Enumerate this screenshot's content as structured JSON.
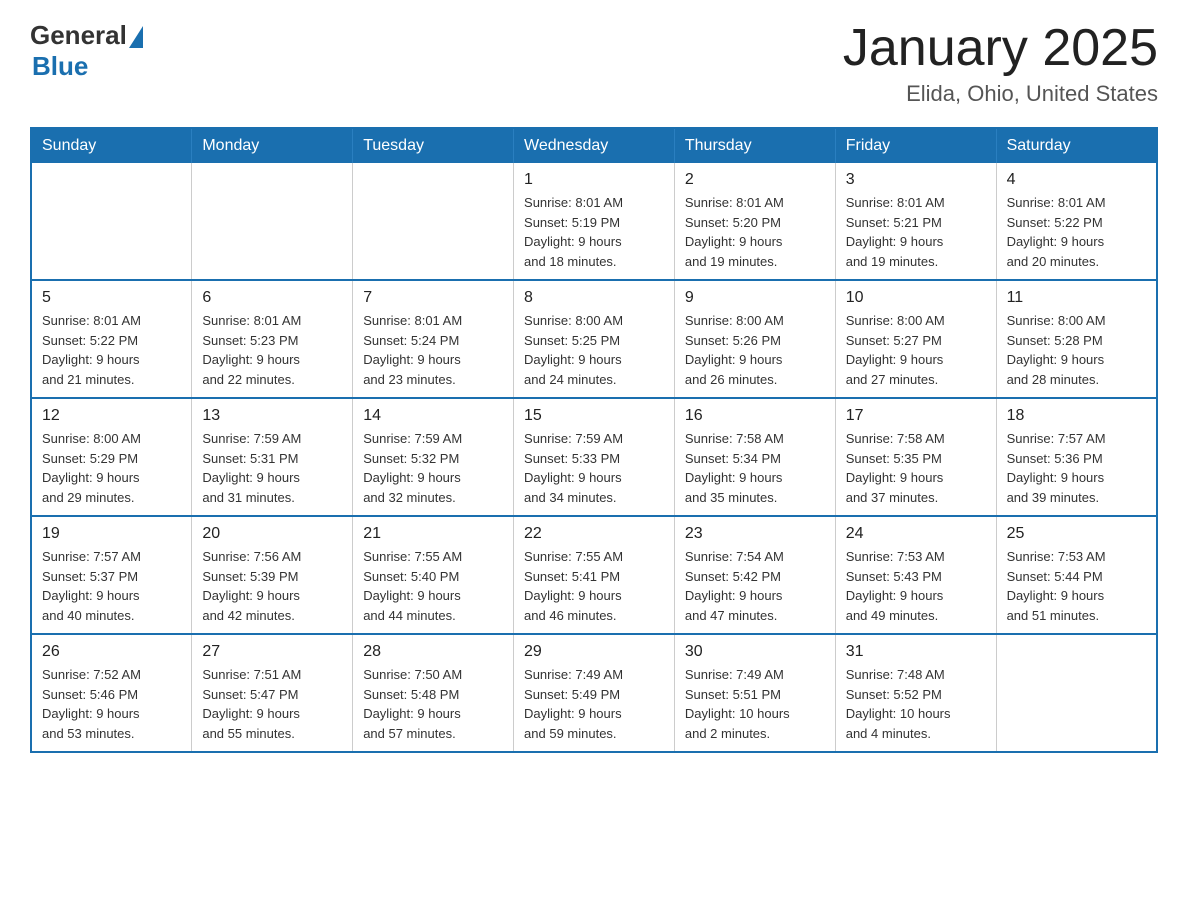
{
  "logo": {
    "general": "General",
    "blue": "Blue"
  },
  "title": "January 2025",
  "location": "Elida, Ohio, United States",
  "days_of_week": [
    "Sunday",
    "Monday",
    "Tuesday",
    "Wednesday",
    "Thursday",
    "Friday",
    "Saturday"
  ],
  "weeks": [
    [
      {
        "day": "",
        "info": ""
      },
      {
        "day": "",
        "info": ""
      },
      {
        "day": "",
        "info": ""
      },
      {
        "day": "1",
        "info": "Sunrise: 8:01 AM\nSunset: 5:19 PM\nDaylight: 9 hours\nand 18 minutes."
      },
      {
        "day": "2",
        "info": "Sunrise: 8:01 AM\nSunset: 5:20 PM\nDaylight: 9 hours\nand 19 minutes."
      },
      {
        "day": "3",
        "info": "Sunrise: 8:01 AM\nSunset: 5:21 PM\nDaylight: 9 hours\nand 19 minutes."
      },
      {
        "day": "4",
        "info": "Sunrise: 8:01 AM\nSunset: 5:22 PM\nDaylight: 9 hours\nand 20 minutes."
      }
    ],
    [
      {
        "day": "5",
        "info": "Sunrise: 8:01 AM\nSunset: 5:22 PM\nDaylight: 9 hours\nand 21 minutes."
      },
      {
        "day": "6",
        "info": "Sunrise: 8:01 AM\nSunset: 5:23 PM\nDaylight: 9 hours\nand 22 minutes."
      },
      {
        "day": "7",
        "info": "Sunrise: 8:01 AM\nSunset: 5:24 PM\nDaylight: 9 hours\nand 23 minutes."
      },
      {
        "day": "8",
        "info": "Sunrise: 8:00 AM\nSunset: 5:25 PM\nDaylight: 9 hours\nand 24 minutes."
      },
      {
        "day": "9",
        "info": "Sunrise: 8:00 AM\nSunset: 5:26 PM\nDaylight: 9 hours\nand 26 minutes."
      },
      {
        "day": "10",
        "info": "Sunrise: 8:00 AM\nSunset: 5:27 PM\nDaylight: 9 hours\nand 27 minutes."
      },
      {
        "day": "11",
        "info": "Sunrise: 8:00 AM\nSunset: 5:28 PM\nDaylight: 9 hours\nand 28 minutes."
      }
    ],
    [
      {
        "day": "12",
        "info": "Sunrise: 8:00 AM\nSunset: 5:29 PM\nDaylight: 9 hours\nand 29 minutes."
      },
      {
        "day": "13",
        "info": "Sunrise: 7:59 AM\nSunset: 5:31 PM\nDaylight: 9 hours\nand 31 minutes."
      },
      {
        "day": "14",
        "info": "Sunrise: 7:59 AM\nSunset: 5:32 PM\nDaylight: 9 hours\nand 32 minutes."
      },
      {
        "day": "15",
        "info": "Sunrise: 7:59 AM\nSunset: 5:33 PM\nDaylight: 9 hours\nand 34 minutes."
      },
      {
        "day": "16",
        "info": "Sunrise: 7:58 AM\nSunset: 5:34 PM\nDaylight: 9 hours\nand 35 minutes."
      },
      {
        "day": "17",
        "info": "Sunrise: 7:58 AM\nSunset: 5:35 PM\nDaylight: 9 hours\nand 37 minutes."
      },
      {
        "day": "18",
        "info": "Sunrise: 7:57 AM\nSunset: 5:36 PM\nDaylight: 9 hours\nand 39 minutes."
      }
    ],
    [
      {
        "day": "19",
        "info": "Sunrise: 7:57 AM\nSunset: 5:37 PM\nDaylight: 9 hours\nand 40 minutes."
      },
      {
        "day": "20",
        "info": "Sunrise: 7:56 AM\nSunset: 5:39 PM\nDaylight: 9 hours\nand 42 minutes."
      },
      {
        "day": "21",
        "info": "Sunrise: 7:55 AM\nSunset: 5:40 PM\nDaylight: 9 hours\nand 44 minutes."
      },
      {
        "day": "22",
        "info": "Sunrise: 7:55 AM\nSunset: 5:41 PM\nDaylight: 9 hours\nand 46 minutes."
      },
      {
        "day": "23",
        "info": "Sunrise: 7:54 AM\nSunset: 5:42 PM\nDaylight: 9 hours\nand 47 minutes."
      },
      {
        "day": "24",
        "info": "Sunrise: 7:53 AM\nSunset: 5:43 PM\nDaylight: 9 hours\nand 49 minutes."
      },
      {
        "day": "25",
        "info": "Sunrise: 7:53 AM\nSunset: 5:44 PM\nDaylight: 9 hours\nand 51 minutes."
      }
    ],
    [
      {
        "day": "26",
        "info": "Sunrise: 7:52 AM\nSunset: 5:46 PM\nDaylight: 9 hours\nand 53 minutes."
      },
      {
        "day": "27",
        "info": "Sunrise: 7:51 AM\nSunset: 5:47 PM\nDaylight: 9 hours\nand 55 minutes."
      },
      {
        "day": "28",
        "info": "Sunrise: 7:50 AM\nSunset: 5:48 PM\nDaylight: 9 hours\nand 57 minutes."
      },
      {
        "day": "29",
        "info": "Sunrise: 7:49 AM\nSunset: 5:49 PM\nDaylight: 9 hours\nand 59 minutes."
      },
      {
        "day": "30",
        "info": "Sunrise: 7:49 AM\nSunset: 5:51 PM\nDaylight: 10 hours\nand 2 minutes."
      },
      {
        "day": "31",
        "info": "Sunrise: 7:48 AM\nSunset: 5:52 PM\nDaylight: 10 hours\nand 4 minutes."
      },
      {
        "day": "",
        "info": ""
      }
    ]
  ]
}
